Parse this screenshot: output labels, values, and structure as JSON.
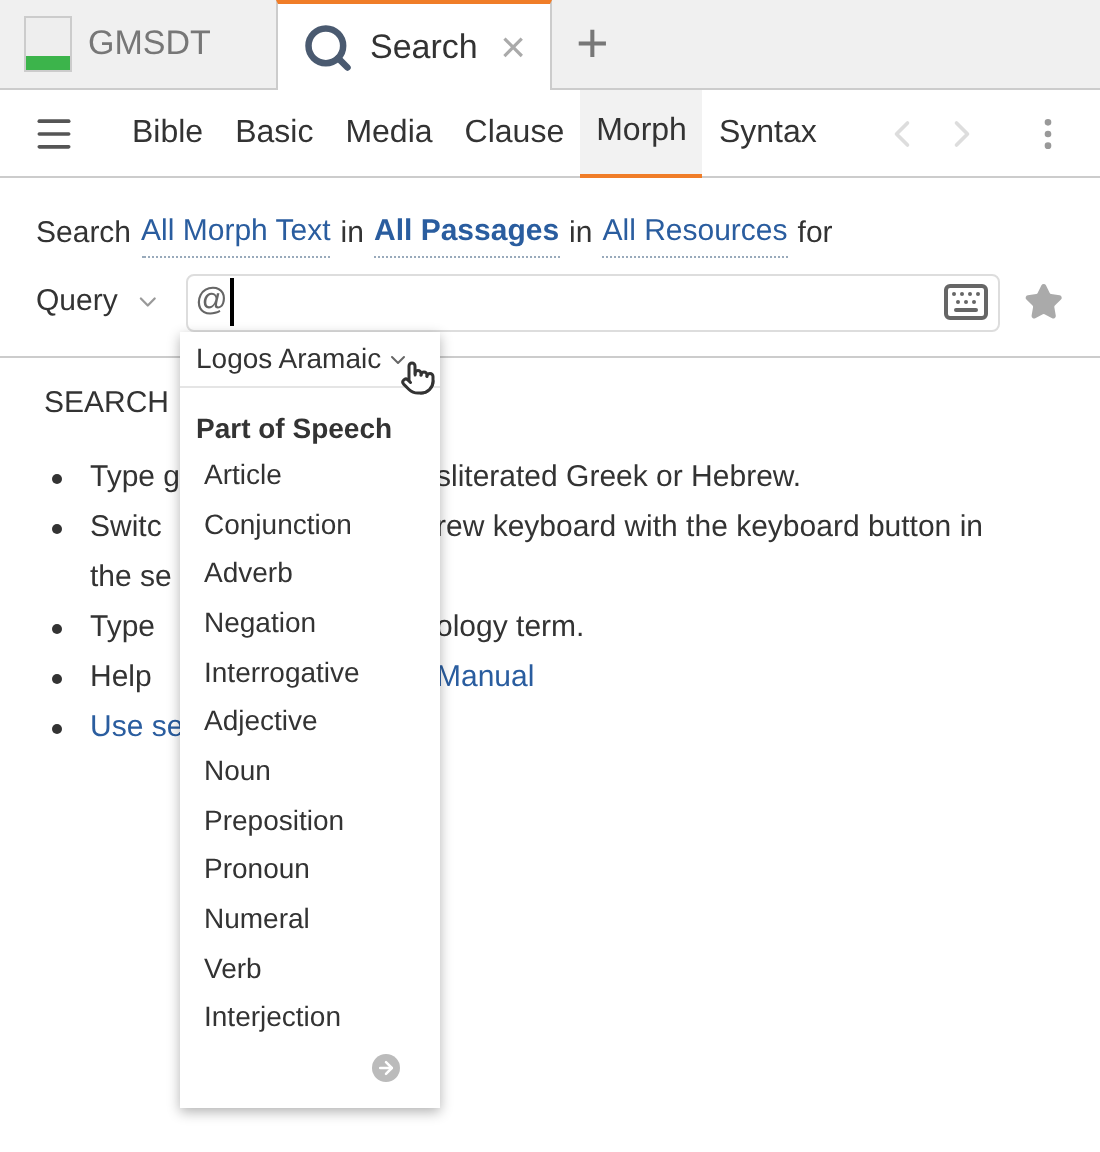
{
  "tabs": [
    {
      "kind": "document",
      "label": "GMSDT",
      "selected": false
    },
    {
      "kind": "search",
      "label": "Search",
      "selected": true,
      "close": "×"
    }
  ],
  "new_tab": "+",
  "search_types": [
    {
      "label": "Bible",
      "selected": false
    },
    {
      "label": "Basic",
      "selected": false
    },
    {
      "label": "Media",
      "selected": false
    },
    {
      "label": "Clause",
      "selected": false
    },
    {
      "label": "Morph",
      "selected": true
    },
    {
      "label": "Syntax",
      "selected": false
    }
  ],
  "scope": [
    {
      "kind": "text",
      "text": "Search"
    },
    {
      "kind": "link",
      "text": "All Morph Text"
    },
    {
      "kind": "text",
      "text": "in"
    },
    {
      "kind": "boldlink",
      "text": "All Passages"
    },
    {
      "kind": "text",
      "text": "in"
    },
    {
      "kind": "link",
      "text": "All Resources"
    },
    {
      "kind": "text",
      "text": "for"
    }
  ],
  "query": {
    "label": "Query",
    "value": "@"
  },
  "help": {
    "heading": "SEARCH",
    "lines": [
      {
        "bullet": true,
        "left": {
          "text": "Type g",
          "link": false
        },
        "right": {
          "text": "sliterated Greek or Hebrew.",
          "link": false
        }
      },
      {
        "bullet": true,
        "left": {
          "text": "Switc",
          "link": false
        },
        "right": {
          "text": "rew keyboard with the keyboard button in",
          "link": false
        }
      },
      {
        "bullet": false,
        "left": {
          "text": "the se",
          "link": false
        }
      },
      {
        "bullet": true,
        "left": {
          "text": "Type",
          "link": false
        },
        "right": {
          "text": "ology term.",
          "link": false
        }
      },
      {
        "bullet": true,
        "left": {
          "text": "Help",
          "link": false
        },
        "right": {
          "text": "Manual",
          "link": true
        }
      },
      {
        "bullet": true,
        "left": {
          "text": "Use se",
          "link": true
        }
      }
    ]
  },
  "popup": {
    "morphology": "Logos Aramaic",
    "section": "Part of Speech",
    "items": [
      "Article",
      "Conjunction",
      "Adverb",
      "Negation",
      "Interrogative",
      "Adjective",
      "Noun",
      "Preposition",
      "Pronoun",
      "Numeral",
      "Verb",
      "Interjection"
    ]
  }
}
